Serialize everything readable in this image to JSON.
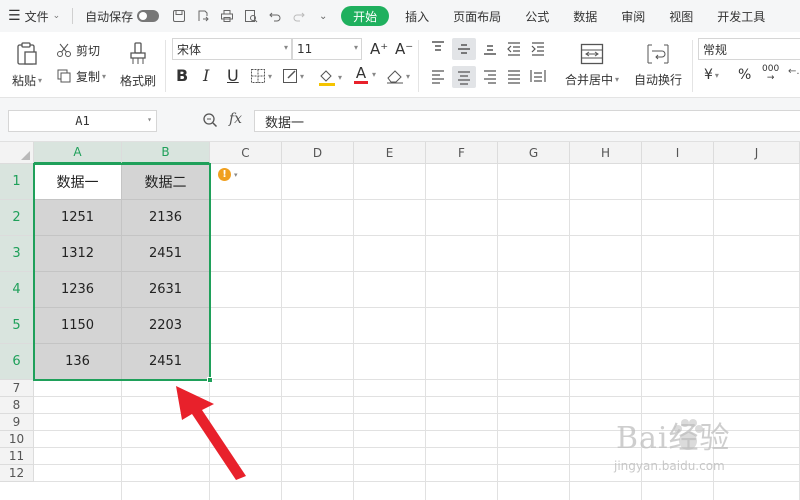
{
  "menubar": {
    "file_label": "文件",
    "autosave_label": "自动保存",
    "tabs": [
      {
        "label": "开始",
        "active": true
      },
      {
        "label": "插入",
        "active": false
      },
      {
        "label": "页面布局",
        "active": false
      },
      {
        "label": "公式",
        "active": false
      },
      {
        "label": "数据",
        "active": false
      },
      {
        "label": "审阅",
        "active": false
      },
      {
        "label": "视图",
        "active": false
      },
      {
        "label": "开发工具",
        "active": false
      }
    ]
  },
  "ribbon": {
    "paste_label": "粘贴",
    "cut_label": "剪切",
    "copy_label": "复制",
    "format_painter_label": "格式刷",
    "font_name": "宋体",
    "font_size": "11",
    "merge_center_label": "合并居中",
    "wrap_text_label": "自动换行",
    "number_format": "常规",
    "bold_glyph": "B",
    "italic_glyph": "I",
    "underline_glyph": "U",
    "grow_font_glyph": "A⁺",
    "shrink_font_glyph": "A⁻",
    "font_color_glyph": "A",
    "currency_glyph": "¥",
    "percent_glyph": "%",
    "thousands_glyph": "000"
  },
  "formula_bar": {
    "cell_ref": "A1",
    "fx_label": "fx",
    "content": "数据一"
  },
  "sheet": {
    "columns": [
      "A",
      "B",
      "C",
      "D",
      "E",
      "F",
      "G",
      "H",
      "I",
      "J"
    ],
    "rows": [
      "1",
      "2",
      "3",
      "4",
      "5",
      "6",
      "7",
      "8",
      "9",
      "10",
      "11",
      "12"
    ],
    "headers": [
      "数据一",
      "数据二"
    ],
    "data": [
      [
        "1251",
        "2136"
      ],
      [
        "1312",
        "2451"
      ],
      [
        "1236",
        "2631"
      ],
      [
        "1150",
        "2203"
      ],
      [
        "136",
        "2451"
      ]
    ]
  },
  "colors": {
    "accent": "#1fb05e",
    "selection_border": "#1fa05a",
    "shaded_cell": "#d4d4d4",
    "arrow": "#e8212b"
  },
  "watermark": {
    "brand": "Bai经验",
    "url": "jingyan.baidu.com"
  }
}
